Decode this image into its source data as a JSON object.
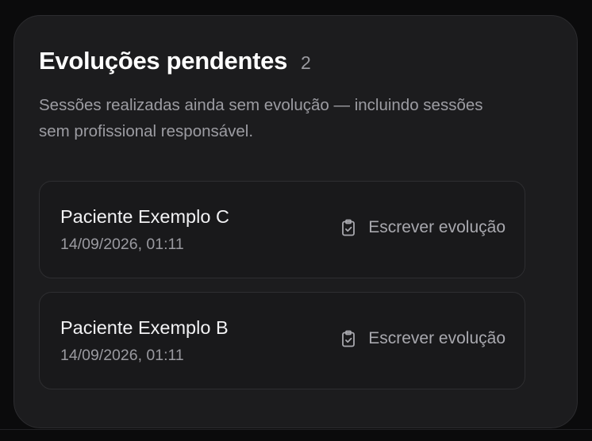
{
  "pending": {
    "title": "Evoluções pendentes",
    "count": "2",
    "description": "Sessões realizadas ainda sem evolução — incluindo sessões sem profissional responsável.",
    "items": [
      {
        "patient": "Paciente Exemplo C",
        "datetime": "14/09/2026, 01:11",
        "action_label": "Escrever evolução",
        "action_icon": "clipboard-check-icon"
      },
      {
        "patient": "Paciente Exemplo B",
        "datetime": "14/09/2026, 01:11",
        "action_label": "Escrever evolução",
        "action_icon": "clipboard-check-icon"
      }
    ]
  }
}
